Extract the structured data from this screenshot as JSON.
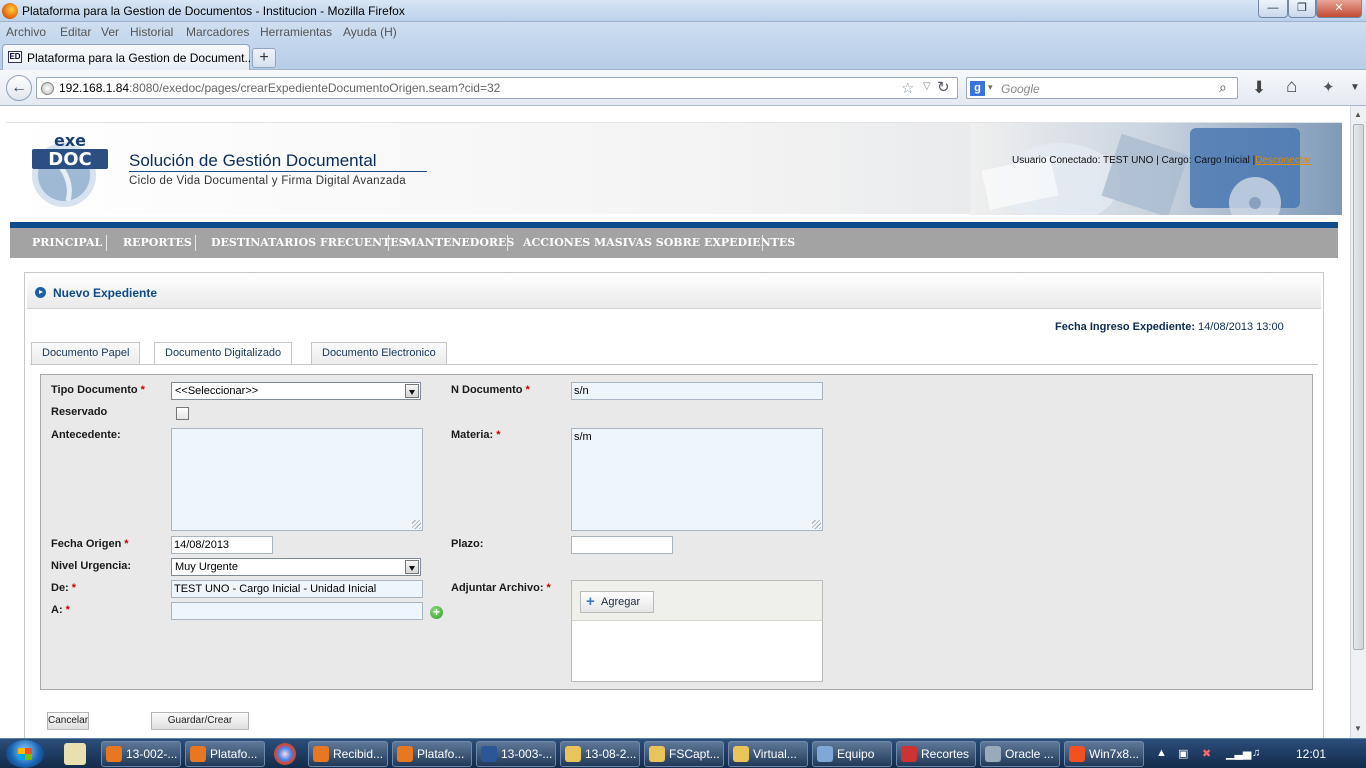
{
  "window": {
    "title": "Plataforma para la Gestion de Documentos - Institucion - Mozilla Firefox",
    "minimize": "0",
    "maximize": "1",
    "close": "r"
  },
  "menubar": [
    "Archivo",
    "Editar",
    "Ver",
    "Historial",
    "Marcadores",
    "Herramientas",
    "Ayuda (H)"
  ],
  "browser_tab": {
    "label": "Plataforma para la Gestion de Document...",
    "new_tab": "+"
  },
  "nav": {
    "url_host": "192.168.1.84",
    "url_rest": ":8080/exedoc/pages/crearExpedienteDocumentoOrigen.seam?cid=32",
    "search_placeholder": "Google",
    "search_engine_letter": "g"
  },
  "header": {
    "logo_top": "exe",
    "logo_main": "DOC",
    "app_title": "Solución de Gestión Documental",
    "app_subtitle": "Ciclo de Vida Documental y Firma Digital Avanzada",
    "user_info": "Usuario Conectado: TEST UNO | Cargo: Cargo Inicial |",
    "logout": "Desconectar"
  },
  "main_nav": [
    "PRINCIPAL",
    "REPORTES",
    "DESTINATARIOS FRECUENTES",
    "MANTENEDORES",
    "ACCIONES MASIVAS SOBRE EXPEDIENTES"
  ],
  "panel": {
    "title": "Nuevo Expediente",
    "fecha_label": "Fecha Ingreso Expediente:",
    "fecha_value": "14/08/2013 13:00"
  },
  "doc_tabs": [
    "Documento Papel",
    "Documento Digitalizado",
    "Documento Electronico"
  ],
  "form": {
    "tipo_documento_label": "Tipo Documento",
    "tipo_documento_value": "<<Seleccionar>>",
    "reservado_label": "Reservado",
    "antecedente_label": "Antecedente:",
    "antecedente_value": "",
    "n_documento_label": "N Documento",
    "n_documento_value": "s/n",
    "materia_label": "Materia:",
    "materia_value": "s/m",
    "fecha_origen_label": "Fecha Origen",
    "fecha_origen_value": "14/08/2013",
    "plazo_label": "Plazo:",
    "plazo_value": "",
    "nivel_urgencia_label": "Nivel Urgencia:",
    "nivel_urgencia_value": "Muy Urgente",
    "de_label": "De:",
    "de_value": "TEST UNO - Cargo Inicial - Unidad Inicial",
    "a_label": "A:",
    "a_value": "",
    "adjuntar_label": "Adjuntar Archivo:",
    "agregar_label": "Agregar",
    "required_mark": "*"
  },
  "actions": {
    "cancelar": "Cancelar",
    "guardar": "Guardar/Crear"
  },
  "taskbar": {
    "items": [
      "13-002-...",
      "Platafo...",
      "Recibid...",
      "Platafo...",
      "13-003-...",
      "13-08-2...",
      "FSCapt...",
      "Virtual...",
      "Equipo",
      "Recortes",
      "Oracle ...",
      "Win7x8..."
    ],
    "clock": "12:01"
  }
}
